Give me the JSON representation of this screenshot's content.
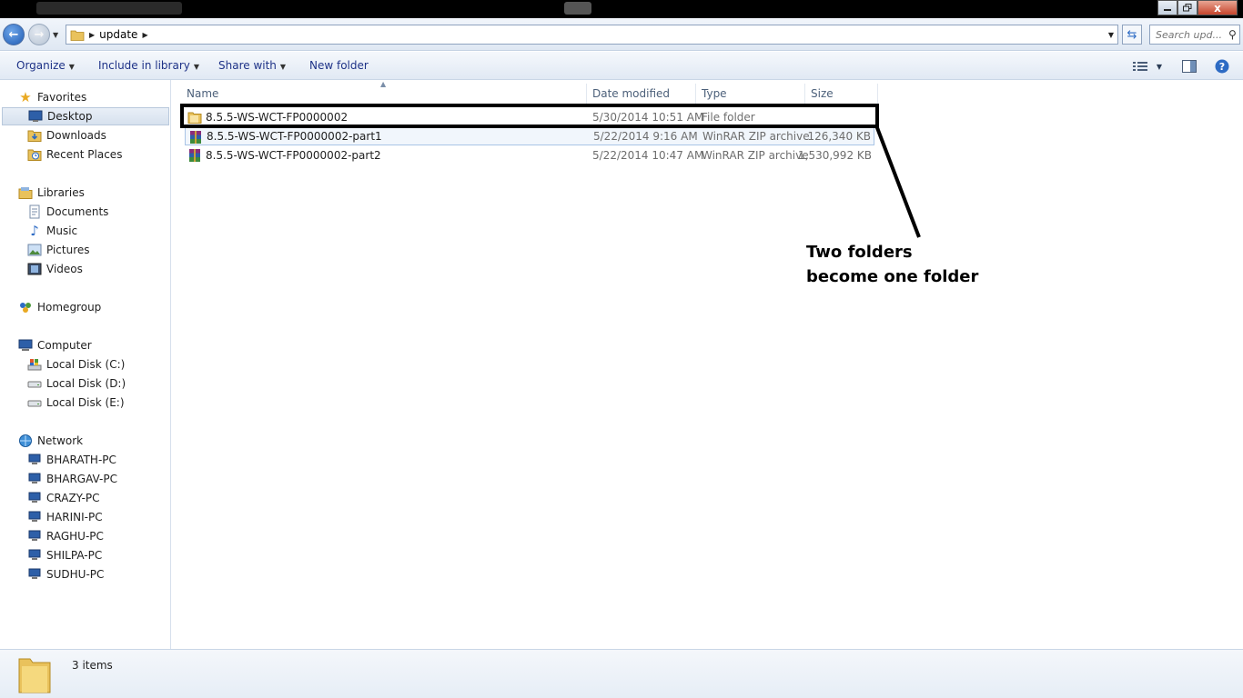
{
  "window": {
    "minimize_icon": "minimize-icon",
    "maximize_icon": "restore-icon",
    "close_label": "x"
  },
  "address": {
    "crumbs": [
      "update"
    ],
    "search_placeholder": "Search upd..."
  },
  "commands": {
    "organize": "Organize",
    "include_in_library": "Include in library",
    "share_with": "Share with",
    "new_folder": "New folder"
  },
  "nav": {
    "favorites": {
      "label": "Favorites",
      "items": [
        "Desktop",
        "Downloads",
        "Recent Places"
      ],
      "selected": "Desktop"
    },
    "libraries": {
      "label": "Libraries",
      "items": [
        "Documents",
        "Music",
        "Pictures",
        "Videos"
      ]
    },
    "homegroup": {
      "label": "Homegroup"
    },
    "computer": {
      "label": "Computer",
      "items": [
        "Local Disk (C:)",
        "Local Disk (D:)",
        "Local Disk (E:)"
      ]
    },
    "network": {
      "label": "Network",
      "items": [
        "BHARATH-PC",
        "BHARGAV-PC",
        "CRAZY-PC",
        "HARINI-PC",
        "RAGHU-PC",
        "SHILPA-PC",
        "SUDHU-PC"
      ]
    }
  },
  "columns": {
    "name": "Name",
    "date_modified": "Date modified",
    "type": "Type",
    "size": "Size"
  },
  "files": [
    {
      "name": "8.5.5-WS-WCT-FP0000002",
      "date": "5/30/2014 10:51 AM",
      "type": "File folder",
      "size": "",
      "icon": "folder-icon"
    },
    {
      "name": "8.5.5-WS-WCT-FP0000002-part1",
      "date": "5/22/2014 9:16 AM",
      "type": "WinRAR ZIP archive",
      "size": "126,340 KB",
      "icon": "winrar-archive-icon"
    },
    {
      "name": "8.5.5-WS-WCT-FP0000002-part2",
      "date": "5/22/2014 10:47 AM",
      "type": "WinRAR ZIP archive",
      "size": "1,530,992 KB",
      "icon": "winrar-archive-icon"
    }
  ],
  "annotation": {
    "line1": "Two folders",
    "line2": "become one folder"
  },
  "status": {
    "item_count": "3 items"
  },
  "colors": {
    "link_text": "#1e3287",
    "selection_border": "#a9c4e6",
    "annotation": "#000000"
  }
}
